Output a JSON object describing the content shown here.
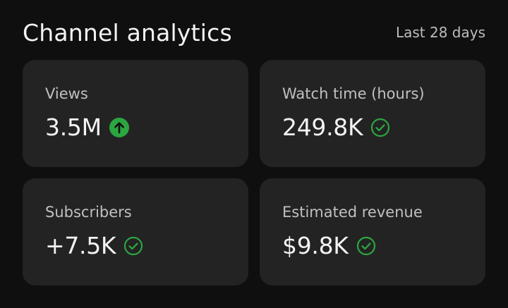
{
  "header": {
    "title": "Channel analytics",
    "period": "Last 28 days"
  },
  "colors": {
    "background": "#0f0f0f",
    "card": "#232323",
    "accent_green": "#2ba640"
  },
  "cards": [
    {
      "label": "Views",
      "value": "3.5M",
      "icon": "arrow-up-circle-icon"
    },
    {
      "label": "Watch time (hours)",
      "value": "249.8K",
      "icon": "check-circle-icon"
    },
    {
      "label": "Subscribers",
      "value": "+7.5K",
      "icon": "check-circle-icon"
    },
    {
      "label": "Estimated revenue",
      "value": "$9.8K",
      "icon": "check-circle-icon"
    }
  ]
}
